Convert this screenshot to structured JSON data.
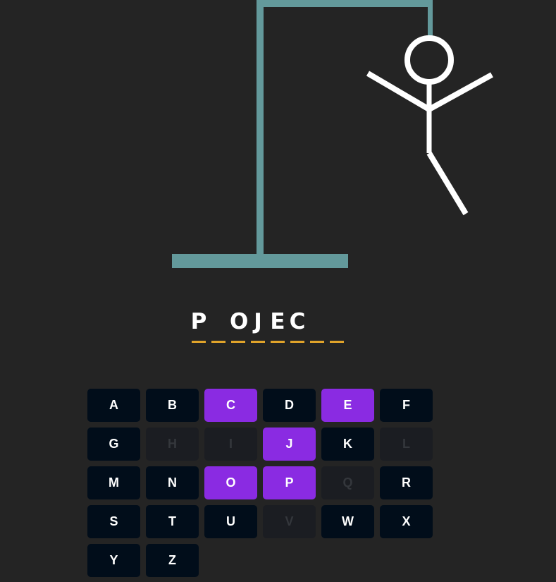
{
  "colors": {
    "background": "#242424",
    "gallows": "#63999b",
    "figure": "#ffffff",
    "word_text": "#ffffff",
    "underline": "#e0a32a",
    "key_default": "#010d1a",
    "key_correct": "#8a2be2",
    "key_wrong": "#1b1d22",
    "key_wrong_text": "#34373c"
  },
  "figure": {
    "parts_shown": [
      "head",
      "body",
      "left-arm",
      "right-arm",
      "right-leg"
    ]
  },
  "word": {
    "letters": [
      "P",
      "",
      "O",
      "J",
      "E",
      "C",
      "",
      ""
    ]
  },
  "keyboard": {
    "keys": [
      {
        "label": "A",
        "state": "unused"
      },
      {
        "label": "B",
        "state": "unused"
      },
      {
        "label": "C",
        "state": "correct"
      },
      {
        "label": "D",
        "state": "unused"
      },
      {
        "label": "E",
        "state": "correct"
      },
      {
        "label": "F",
        "state": "unused"
      },
      {
        "label": "G",
        "state": "unused"
      },
      {
        "label": "H",
        "state": "wrong"
      },
      {
        "label": "I",
        "state": "wrong"
      },
      {
        "label": "J",
        "state": "correct"
      },
      {
        "label": "K",
        "state": "unused"
      },
      {
        "label": "L",
        "state": "wrong"
      },
      {
        "label": "M",
        "state": "unused"
      },
      {
        "label": "N",
        "state": "unused"
      },
      {
        "label": "O",
        "state": "correct"
      },
      {
        "label": "P",
        "state": "correct"
      },
      {
        "label": "Q",
        "state": "wrong"
      },
      {
        "label": "R",
        "state": "unused"
      },
      {
        "label": "S",
        "state": "unused"
      },
      {
        "label": "T",
        "state": "unused"
      },
      {
        "label": "U",
        "state": "unused"
      },
      {
        "label": "V",
        "state": "wrong"
      },
      {
        "label": "W",
        "state": "unused"
      },
      {
        "label": "X",
        "state": "unused"
      },
      {
        "label": "Y",
        "state": "unused"
      },
      {
        "label": "Z",
        "state": "unused"
      }
    ]
  }
}
